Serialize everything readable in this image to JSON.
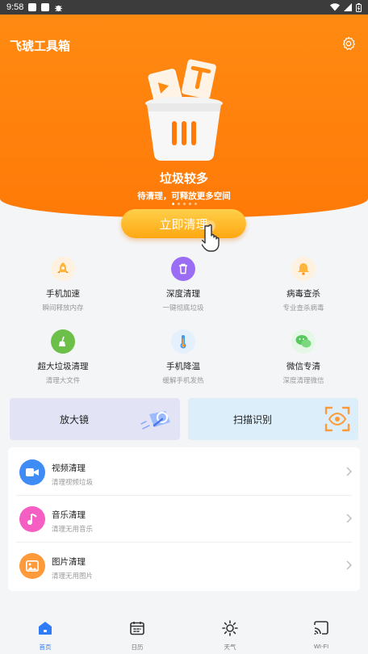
{
  "status_bar": {
    "time": "9:58"
  },
  "app": {
    "title": "飞琥工具箱"
  },
  "hero": {
    "status_title": "垃圾较多",
    "status_subtitle": "待清理，可释放更多空间",
    "clean_button": "立即清理"
  },
  "features": [
    {
      "name": "手机加速",
      "desc": "瞬间释放内存",
      "icon": "rocket-icon",
      "color": "#ffb43a"
    },
    {
      "name": "深度清理",
      "desc": "一键彻底垃圾",
      "icon": "trash-icon",
      "color": "#9b6df5"
    },
    {
      "name": "病毒查杀",
      "desc": "专业查杀病毒",
      "icon": "bell-icon",
      "color": "#ffb43a"
    },
    {
      "name": "超大垃圾清理",
      "desc": "清理大文件",
      "icon": "broom-icon",
      "color": "#6cc04a"
    },
    {
      "name": "手机降温",
      "desc": "缓解手机发热",
      "icon": "thermometer-icon",
      "color": "#3d9cf2"
    },
    {
      "name": "微信专清",
      "desc": "深度清理微信",
      "icon": "wechat-icon",
      "color": "#57c95e"
    }
  ],
  "cards": {
    "magnifier": "放大镜",
    "scan": "扫描识别"
  },
  "list": [
    {
      "name": "视频清理",
      "desc": "清理视频垃圾",
      "icon": "video-icon",
      "color": "#3f8cf5"
    },
    {
      "name": "音乐清理",
      "desc": "清理无用音乐",
      "icon": "music-icon",
      "color": "#f55fc3"
    },
    {
      "name": "图片清理",
      "desc": "清理无用图片",
      "icon": "image-icon",
      "color": "#ff9a3a"
    }
  ],
  "tabs": [
    {
      "label": "首页",
      "icon": "home-icon",
      "active": true
    },
    {
      "label": "日历",
      "icon": "calendar-icon",
      "active": false
    },
    {
      "label": "天气",
      "icon": "sun-icon",
      "active": false
    },
    {
      "label": "WI-FI",
      "icon": "cast-icon",
      "active": false
    }
  ],
  "colors": {
    "accent": "#ff7f0e",
    "button": "#ffb52a",
    "active_tab": "#2f7cf6"
  }
}
